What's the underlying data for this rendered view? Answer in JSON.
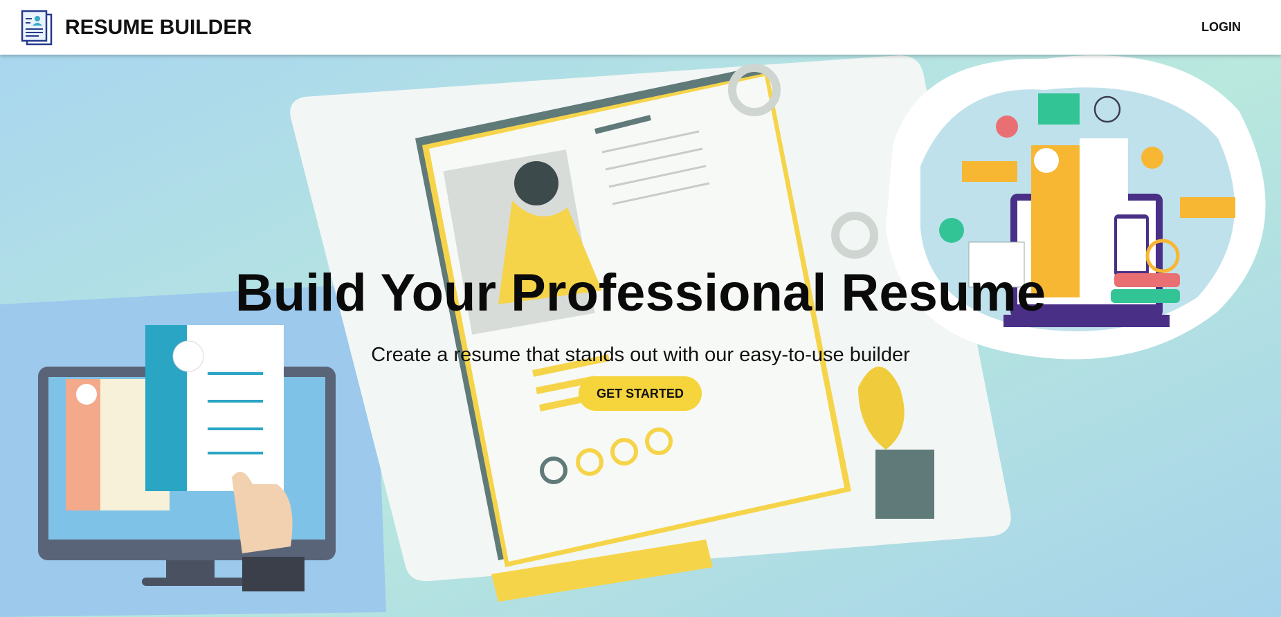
{
  "header": {
    "logo_icon": "resume-document-icon",
    "brand": "RESUME BUILDER",
    "login_label": "LOGIN"
  },
  "hero": {
    "title": "Build Your Professional Resume",
    "subtitle": "Create a resume that stands out with our easy-to-use builder",
    "cta_label": "GET STARTED",
    "illustration": "resume-illustration-background"
  },
  "colors": {
    "accent": "#f5d43c",
    "background_start": "#a9d6ee",
    "background_end": "#b9e8de",
    "text": "#0a0a0a"
  }
}
